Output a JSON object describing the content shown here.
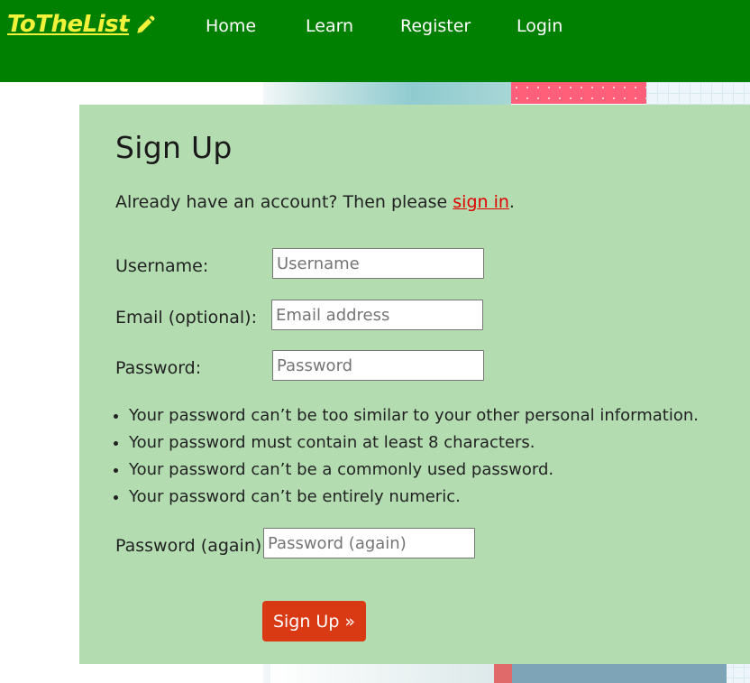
{
  "nav": {
    "brand": "ToTheList",
    "items": [
      "Home",
      "Learn",
      "Register",
      "Login"
    ]
  },
  "form": {
    "title": "Sign Up",
    "signin_prefix": "Already have an account? Then please ",
    "signin_link": "sign in",
    "signin_suffix": ".",
    "username_label": "Username:",
    "username_placeholder": "Username",
    "email_label": "Email (optional):",
    "email_placeholder": "Email address",
    "password_label": "Password:",
    "password_placeholder": "Password",
    "password_rules": [
      "Your password can’t be too similar to your other personal information.",
      "Your password must contain at least 8 characters.",
      "Your password can’t be a commonly used password.",
      "Your password can’t be entirely numeric."
    ],
    "password2_label": "Password (again):",
    "password2_placeholder": "Password (again)",
    "submit_label": "Sign Up »"
  },
  "colors": {
    "navbar": "#008000",
    "brand": "#f2f23a",
    "card": "#b3dcb1",
    "link": "#e00000",
    "button": "#d93a14"
  },
  "icons": {
    "brand_icon": "pencil-icon"
  }
}
